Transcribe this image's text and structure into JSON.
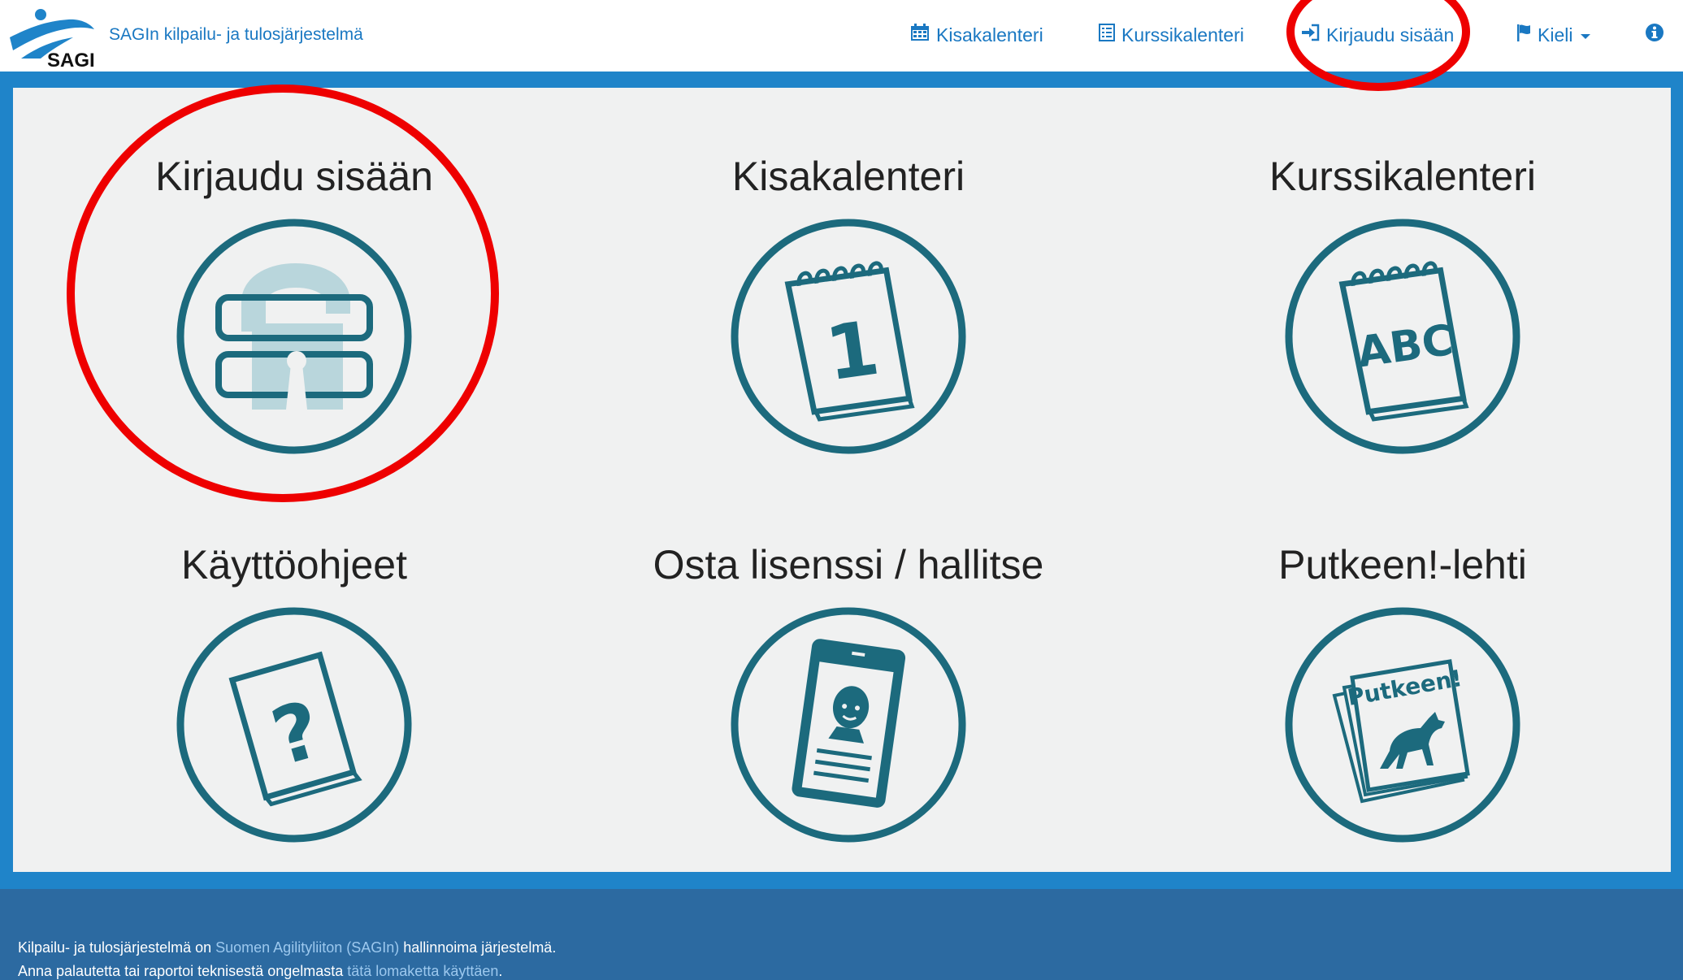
{
  "header": {
    "brand_text": "SAGIn kilpailu- ja tulosjärjestelmä",
    "logo_text": "SAGI",
    "nav": [
      {
        "label": "Kisakalenteri",
        "icon": "calendar-icon"
      },
      {
        "label": "Kurssikalenteri",
        "icon": "list-icon"
      },
      {
        "label": "Kirjaudu sisään",
        "icon": "sign-in-icon"
      },
      {
        "label": "Kieli",
        "icon": "flag-icon"
      }
    ],
    "info_icon": "info-icon"
  },
  "tiles": [
    {
      "title": "Kirjaudu sisään",
      "icon": "padlock-icon"
    },
    {
      "title": "Kisakalenteri",
      "icon": "calendar-1-icon",
      "icon_text": "1"
    },
    {
      "title": "Kurssikalenteri",
      "icon": "calendar-abc-icon",
      "icon_text": "ABC"
    },
    {
      "title": "Käyttöohjeet",
      "icon": "help-book-icon",
      "icon_text": "?"
    },
    {
      "title": "Osta lisenssi / hallitse",
      "icon": "id-card-icon"
    },
    {
      "title": "Putkeen!-lehti",
      "icon": "magazine-icon",
      "icon_text": "Putkeen!"
    }
  ],
  "footer": {
    "line1_pre": "Kilpailu- ja tulosjärjestelmä on ",
    "line1_link": "Suomen Agilityliiton (SAGIn)",
    "line1_post": " hallinnoima järjestelmä.",
    "line2_pre": "Anna palautetta tai raportoi teknisestä ongelmasta ",
    "line2_link": "tätä lomaketta käyttäen",
    "line2_post": "."
  },
  "colors": {
    "accent": "#1f84c9",
    "link": "#1a78c2",
    "icon_teal": "#1c6a7d",
    "marker_red": "#ee0000",
    "footer": "#2c6aa1"
  }
}
